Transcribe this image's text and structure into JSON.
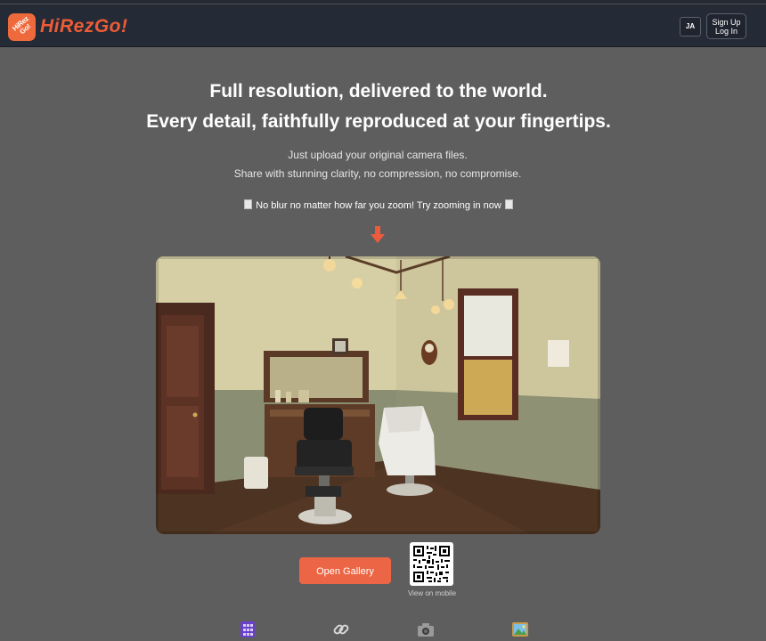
{
  "app": {
    "brand": "HiRezGo!",
    "logo_text": "HiRez Go!"
  },
  "header": {
    "language_label": "JA",
    "signup_label": "Sign Up",
    "login_label": "Log In"
  },
  "hero": {
    "headline_line1": "Full resolution, delivered to the world.",
    "headline_line2": "Every detail, faithfully reproduced at your fingertips.",
    "sub_line1": "Just upload your original camera files.",
    "sub_line2": "Share with stunning clarity, no compression, no compromise.",
    "zoom_note": "No blur no matter how far you zoom! Try zooming in now"
  },
  "actions": {
    "gallery_label": "Open Gallery",
    "mobile_label": "View on mobile"
  },
  "icons": {
    "arrow": "down-arrow-icon",
    "bottom": [
      "grid-icon",
      "link-icon",
      "camera-icon",
      "image-icon"
    ]
  },
  "colors": {
    "accent": "#ec6544",
    "header_bg": "#242a36",
    "page_bg": "#5e5e5e"
  }
}
